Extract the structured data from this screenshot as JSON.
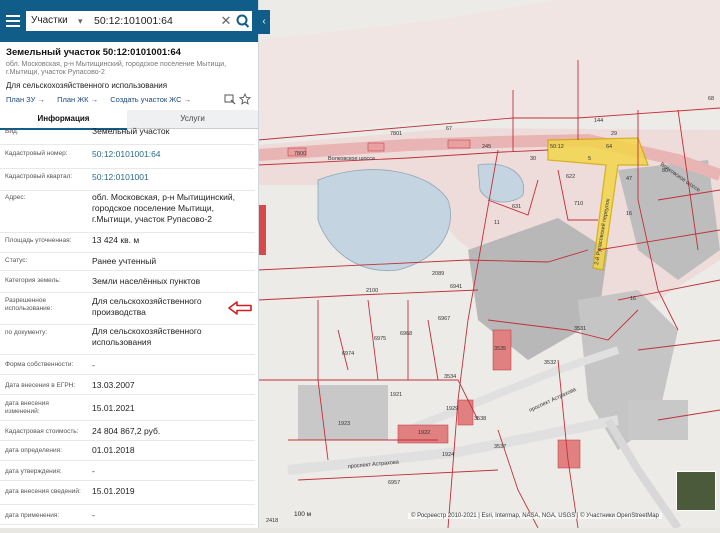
{
  "search": {
    "category": "Участки",
    "query": "50:12:101001:64"
  },
  "card": {
    "title": "Земельный участок 50:12:0101001:64",
    "address": "обл. Московская, р-н Мытищинский, городское поселение Мытищи, г.Мытищи, участок Рупасово-2",
    "purpose": "Для сельскохозяйственного использования",
    "links": [
      "План ЗУ →",
      "План ЖК →",
      "Создать участок ЖС →"
    ]
  },
  "tabs": [
    "Информация",
    "Услуги"
  ],
  "rows": [
    {
      "label": "Вид:",
      "value": "Земельный участок"
    },
    {
      "label": "Кадастровый номер:",
      "value": "50:12:0101001:64"
    },
    {
      "label": "Кадастровый квартал:",
      "value": "50:12:0101001"
    },
    {
      "label": "Адрес:",
      "value": "обл. Московская, р-н Мытищинский, городское поселение Мытищи, г.Мытищи, участок Рупасово-2"
    },
    {
      "label": "Площадь уточненная:",
      "value": "13 424 кв. м"
    },
    {
      "label": "Статус:",
      "value": "Ранее учтенный"
    },
    {
      "label": "Категория земель:",
      "value": "Земли населённых пунктов"
    },
    {
      "label": "Разрешенное использование:",
      "value": "Для сельскохозяйственного производства"
    },
    {
      "label": "по документу:",
      "value": "Для сельскохозяйственного использования"
    },
    {
      "label": "Форма собственности:",
      "value": "-"
    },
    {
      "label": "Дата внесения в ЕГРН:",
      "value": "13.03.2007"
    },
    {
      "label": "дата внесения изменений:",
      "value": "15.01.2021"
    },
    {
      "label": "Кадастровая стоимость:",
      "value": "24 804 867,2 руб."
    },
    {
      "label": "дата определения:",
      "value": "01.01.2018"
    },
    {
      "label": "дата утверждения:",
      "value": "-"
    },
    {
      "label": "дата внесения сведений:",
      "value": "15.01.2019"
    },
    {
      "label": "дата применения:",
      "value": "-"
    }
  ],
  "map": {
    "roads": [
      "Волковское шоссе",
      "Волковское шоссе",
      "проспект Астрахова",
      "проспект Астрахова",
      "2-й Рупасовский переулок"
    ],
    "parcel_labels": [
      "7800",
      "7801",
      "67",
      "144",
      "29",
      "68",
      "245",
      "30",
      "5",
      "47",
      "80",
      "622",
      "710",
      "16",
      "631",
      "11",
      "2089",
      "6941",
      "2100",
      "6967",
      "6968",
      "6975",
      "6974",
      "3535",
      "3531",
      "3532",
      "3534",
      "1921",
      "1923",
      "1922",
      "1924",
      "1929",
      "3538",
      "3537",
      "6957",
      "2418",
      "50:12",
      "64",
      "16"
    ],
    "scale_label": "100 м",
    "attribution": "© Росреестр 2010-2021 | Esri, Intermap, NASA, NGA, USGS | © Участники OpenStreetMap"
  },
  "colors": {
    "header": "#0f5d88",
    "parcel_border": "#c0303a",
    "selected_parcel": "#f2d54a",
    "road": "#e8b4b4",
    "water": "#c4d4e0"
  }
}
